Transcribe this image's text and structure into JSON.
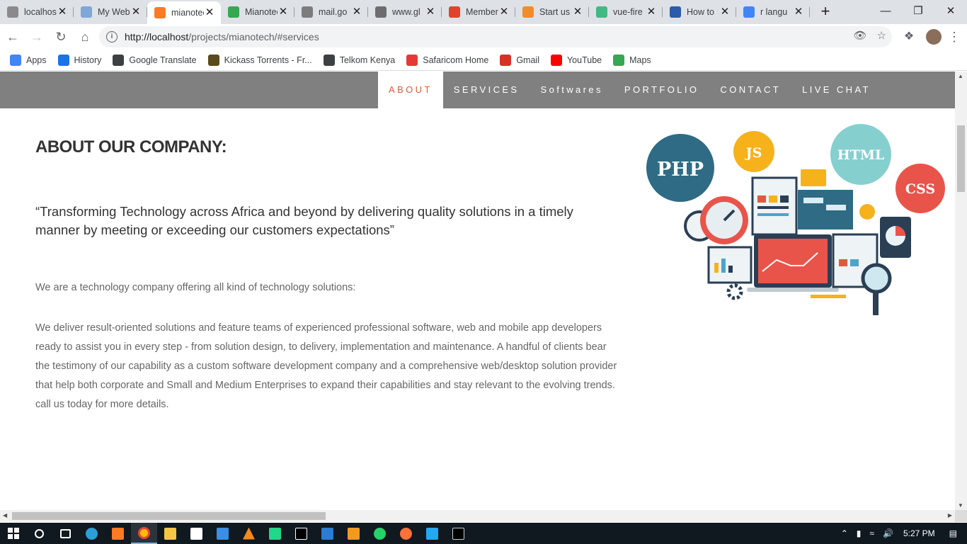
{
  "browser": {
    "tabs": [
      {
        "title": "localhost",
        "favicon_color": "#8a8a8a",
        "active": false
      },
      {
        "title": "My Web",
        "favicon_color": "#7fa7d8",
        "active": false
      },
      {
        "title": "mianotech",
        "favicon_color": "#fb7a24",
        "active": true
      },
      {
        "title": "Mianotech",
        "favicon_color": "#36a852",
        "active": false
      },
      {
        "title": "mail.go",
        "favicon_color": "#7d7d7d",
        "active": false
      },
      {
        "title": "www.gl",
        "favicon_color": "#6d6d6d",
        "active": false
      },
      {
        "title": "Members",
        "favicon_color": "#e2432a",
        "active": false
      },
      {
        "title": "Start us",
        "favicon_color": "#f28b2b",
        "active": false
      },
      {
        "title": "vue-fire",
        "favicon_color": "#42b883",
        "active": false
      },
      {
        "title": "How to",
        "favicon_color": "#2c5ba8",
        "active": false
      },
      {
        "title": "r langu",
        "favicon_color": "#4285f4",
        "active": false
      }
    ],
    "url_host": "http://localhost",
    "url_path": "/projects/mianotech/#services"
  },
  "bookmarks": [
    {
      "label": "Apps",
      "color": "#4285f4"
    },
    {
      "label": "History",
      "color": "#1a73e8"
    },
    {
      "label": "Google Translate",
      "color": "#3c4043"
    },
    {
      "label": "Kickass Torrents - Fr...",
      "color": "#5b4a1e"
    },
    {
      "label": "Telkom Kenya",
      "color": "#3c4043"
    },
    {
      "label": "Safaricom Home",
      "color": "#e53935"
    },
    {
      "label": "Gmail",
      "color": "#d93025"
    },
    {
      "label": "YouTube",
      "color": "#ff0000"
    },
    {
      "label": "Maps",
      "color": "#34a853"
    }
  ],
  "nav": {
    "items": [
      "ABOUT",
      "SERVICES",
      "Softwares",
      "PORTFOLIO",
      "CONTACT",
      "LIVE CHAT"
    ],
    "active": "ABOUT"
  },
  "about": {
    "heading": "ABOUT OUR COMPANY:",
    "quote": "“Transforming Technology across Africa and beyond by delivering quality solutions in a timely manner by meeting or exceeding our customers expectations”",
    "intro": "We are a technology company offering all kind of technology solutions:",
    "body": "We deliver result-oriented solutions and feature teams of experienced professional software, web and mobile app developers ready to assist you in every step - from solution design, to delivery, implementation and maintenance. A handful of clients bear the testimony of our capability as a custom software development company and a comprehensive web/desktop solution provider that help both corporate and Small and Medium Enterprises to expand their capabilities and stay relevant to the evolving trends. call us today for more details."
  },
  "illustration": {
    "bubbles": [
      "PHP",
      "JS",
      "HTML",
      "CSS"
    ]
  },
  "taskbar": {
    "time": "5:27 PM"
  }
}
